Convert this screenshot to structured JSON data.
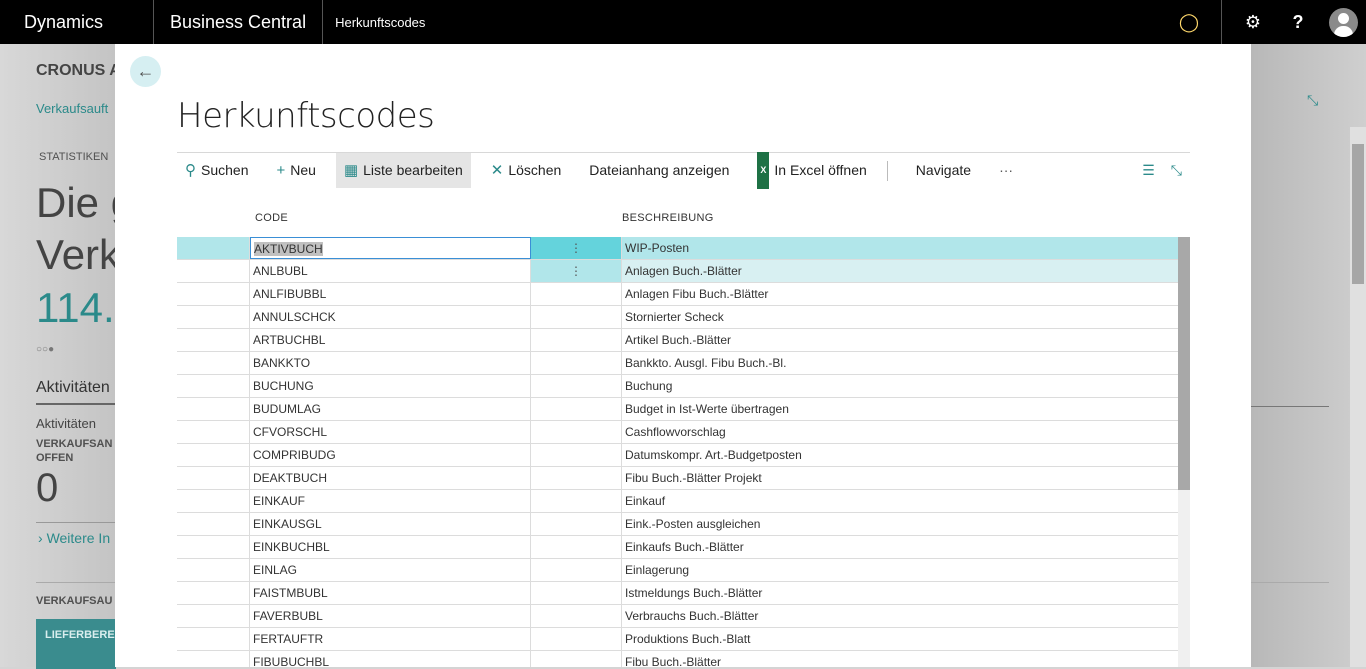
{
  "topbar": {
    "product": "Dynamics 365",
    "app": "Business Central",
    "page": "Herkunftscodes",
    "icons": [
      "lightbulb-icon",
      "gear-icon",
      "help-icon",
      "avatar"
    ],
    "help_label": "?"
  },
  "background": {
    "company": "CRONUS A",
    "link": "Verkaufsauft",
    "stats_label": "STATISTIKEN",
    "big1": "Die g",
    "big2": "Verk",
    "amount": "114.7",
    "activities_heading": "Aktivitäten",
    "activities_dropdown": "Aktivitäten",
    "cue_label1": "VERKAUFSAN",
    "cue_label2": "OFFEN",
    "cue_value": "0",
    "more_link": "Weitere In",
    "section2": "VERKAUFSAU",
    "tile_label": "LIEFERBERE",
    "accent": "#2b8a8a"
  },
  "modal": {
    "title": "Herkunftscodes",
    "toolbar": {
      "search": "Suchen",
      "new": "Neu",
      "edit_list": "Liste bearbeiten",
      "delete": "Löschen",
      "attachments": "Dateianhang anzeigen",
      "excel": "In Excel öffnen",
      "navigate": "Navigate",
      "more": "···"
    },
    "columns": {
      "code": "CODE",
      "description": "BESCHREIBUNG"
    },
    "rows": [
      {
        "code": "AKTIVBUCH",
        "description": "WIP-Posten"
      },
      {
        "code": "ANLBUBL",
        "description": "Anlagen Buch.-Blätter"
      },
      {
        "code": "ANLFIBUBBL",
        "description": "Anlagen Fibu Buch.-Blätter"
      },
      {
        "code": "ANNULSCHCK",
        "description": "Stornierter Scheck"
      },
      {
        "code": "ARTBUCHBL",
        "description": "Artikel Buch.-Blätter"
      },
      {
        "code": "BANKKTO",
        "description": "Bankkto. Ausgl. Fibu Buch.-Bl."
      },
      {
        "code": "BUCHUNG",
        "description": "Buchung"
      },
      {
        "code": "BUDUMLAG",
        "description": "Budget in Ist-Werte übertragen"
      },
      {
        "code": "CFVORSCHL",
        "description": "Cashflowvorschlag"
      },
      {
        "code": "COMPRIBUDG",
        "description": "Datumskompr. Art.-Budgetposten"
      },
      {
        "code": "DEAKTBUCH",
        "description": "Fibu Buch.-Blätter Projekt"
      },
      {
        "code": "EINKAUF",
        "description": "Einkauf"
      },
      {
        "code": "EINKAUSGL",
        "description": "Eink.-Posten ausgleichen"
      },
      {
        "code": "EINKBUCHBL",
        "description": "Einkaufs Buch.-Blätter"
      },
      {
        "code": "EINLAG",
        "description": "Einlagerung"
      },
      {
        "code": "FAISTMBUBL",
        "description": "Istmeldungs Buch.-Blätter"
      },
      {
        "code": "FAVERBUBL",
        "description": "Verbrauchs Buch.-Blätter"
      },
      {
        "code": "FERTAUFTR",
        "description": "Produktions Buch.-Blatt"
      },
      {
        "code": "FIBUBUCHBL",
        "description": "Fibu Buch.-Blätter"
      }
    ],
    "selected_row": "AKTIVBUCH"
  }
}
